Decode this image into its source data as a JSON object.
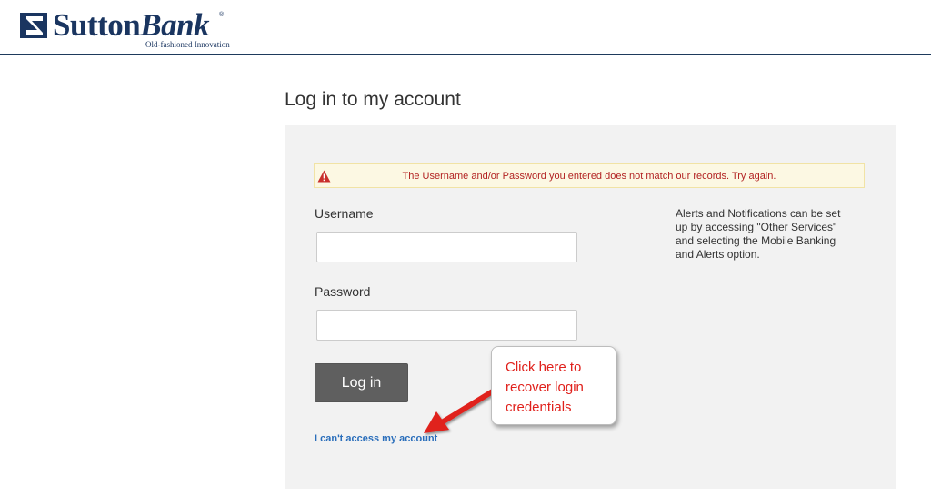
{
  "brand": {
    "name_part1": "Sutton",
    "name_part2": "Bank",
    "registered": "®",
    "tagline": "Old-fashioned Innovation",
    "primary_color": "#1a3560"
  },
  "page": {
    "title": "Log in to my account"
  },
  "alert": {
    "icon": "warning-triangle-icon",
    "message": "The Username and/or Password you entered does not match our records. Try again.",
    "color": "#b22222"
  },
  "form": {
    "username_label": "Username",
    "username_value": "",
    "password_label": "Password",
    "password_value": "",
    "login_button": "Log in",
    "help_link": "I can't access my account"
  },
  "side_note": "Alerts and Notifications can be set up by accessing \"Other Services\" and selecting the Mobile Banking and Alerts option.",
  "annotation": {
    "callout_lines": [
      "Click here to",
      "recover login",
      "credentials"
    ],
    "callout_color": "#e0201b",
    "arrow_icon": "red-arrow-icon"
  }
}
